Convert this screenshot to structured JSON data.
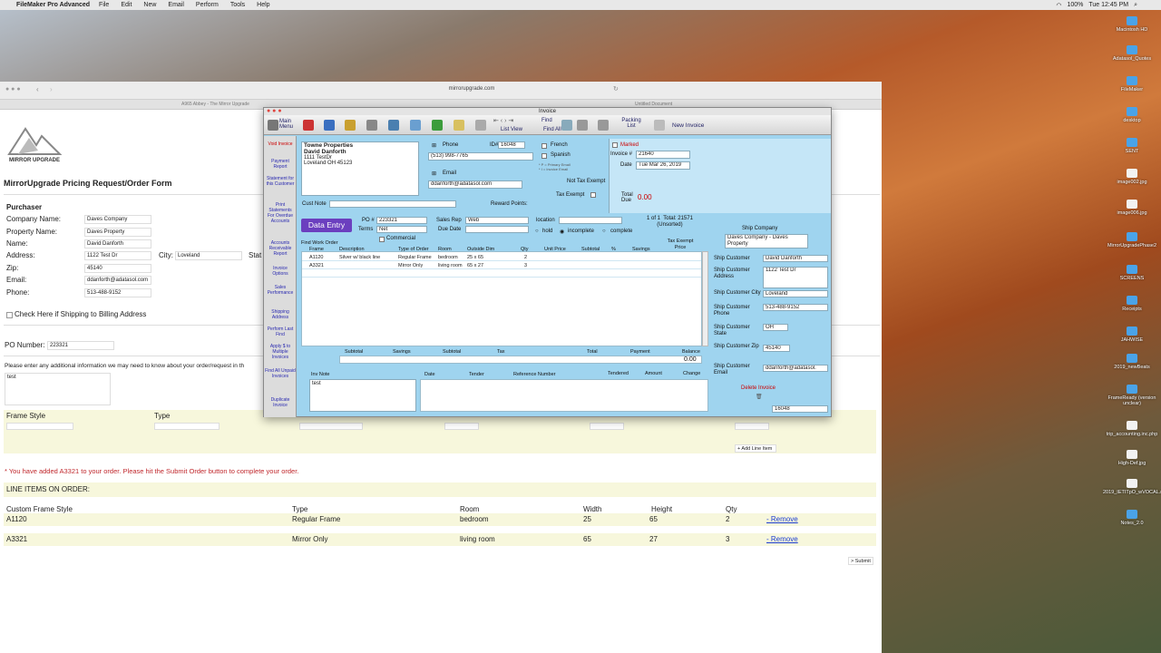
{
  "menubar": {
    "apple": "",
    "app": "FileMaker Pro Advanced",
    "items": [
      "File",
      "Edit",
      "New",
      "Email",
      "Perform",
      "Tools",
      "Help"
    ],
    "battery": "100%",
    "clock": "Tue 12:45 PM"
  },
  "desktop": [
    "Macintosh HD",
    "Adatasol_Quotes",
    "FileMaker",
    "desktop",
    "SENT",
    "image002.jpg",
    "image006.jpg",
    "MirrorUpgradePhase2",
    "SCREENS",
    "Receipts",
    "JAHWISE",
    "2019_newBeats",
    "FrameReady (version unclear)",
    "trip_accounting.inc.php",
    "High-Def.jpg",
    "2019_IETITpO_wVOCAL.mp3",
    "Notes_2.0"
  ],
  "safari": {
    "url": "mirrorupgrade.com",
    "tab1": "A965 Abbey - The Mirror Upgrade",
    "tab2": "Untitled Document"
  },
  "web": {
    "logo": "MIRROR UPGRADE",
    "heading": "MirrorUpgrade Pricing Request/Order Form",
    "purchaser": "Purchaser",
    "company_label": "Company Name:",
    "company": "Daves Company",
    "property_label": "Property Name:",
    "property": "Daves Property",
    "name_label": "Name:",
    "name": "David Danforth",
    "address_label": "Address:",
    "address": "1122 Test Dr",
    "city_label": "City:",
    "city": "Loveland",
    "state_label": "Stat",
    "zip_label": "Zip:",
    "zip": "45140",
    "email_label": "Email:",
    "email": "ddanforth@adatasol.com",
    "phone_label": "Phone:",
    "phone": "513-488-9152",
    "shipping_check": "Check Here if Shipping to Billing Address",
    "po_label": "PO Number:",
    "po": "223321",
    "info_text": "Please enter any additional information we may need to know about your order/request in th",
    "notes": "test",
    "frame_style_label": "Frame Style",
    "type_label": "Type",
    "add_line_item": "+ Add Line Item",
    "added_msg": "* You have added A3321 to your order. Please hit the Submit Order button to complete your order.",
    "line_items_title": "LINE ITEMS ON ORDER:",
    "cols": [
      "Custom Frame Style",
      "Type",
      "Room",
      "Width",
      "Height",
      "Qty"
    ],
    "rows": [
      {
        "style": "A1120",
        "type": "Regular Frame",
        "room": "bedroom",
        "width": "25",
        "height": "65",
        "qty": "2",
        "action": "- Remove"
      },
      {
        "style": "A3321",
        "type": "Mirror Only",
        "room": "living room",
        "width": "65",
        "height": "27",
        "qty": "3",
        "action": "- Remove"
      }
    ],
    "submit": "> Submit"
  },
  "fm": {
    "title": "Invoice",
    "toolbar": {
      "main_menu": "Main Menu",
      "list_view": "List View",
      "find": "Find",
      "find_all": "Find All",
      "packing": "Packing List",
      "new_invoice": "New Invoice"
    },
    "side": [
      "Void Invoice",
      "Payment Report",
      "Statement for this Customer",
      "Print Statements For Overdue Accounts",
      "Accounts Receivable Report",
      "Invoice Options",
      "Sales Performance",
      "Shipping Address",
      "Perform Last Find",
      "Apply $ to Multiple Invoices",
      "Find All Unpaid Invoices",
      "Duplicate Invoice"
    ],
    "bill_to": [
      "Towne Properties",
      "David Danforth",
      "1111 TestDr",
      "Loveland OH 45123"
    ],
    "phone_label": "Phone",
    "id_label": "ID#",
    "id": "16048",
    "phone": "(513) 998-7765",
    "french": "French",
    "spanish": "Spanish",
    "primary_note": "* P = Primary Email\n* I = Invoice Email",
    "email_label": "Email",
    "email": "ddanforth@adatasol.com",
    "not_tax_exempt": "Not Tax Exempt",
    "tax_exempt": "Tax Exempt",
    "marked": "Marked",
    "invoice_label": "Invoice #",
    "invoice": "21640",
    "date_label": "Date",
    "date": "Tue Mar 26, 2019",
    "total_due_label": "Total Due",
    "total_due": "0.00",
    "cust_note": "Cust Note",
    "reward_points": "Reward Points:",
    "data_entry": "Data Entry",
    "po_label": "PO #",
    "po": "223321",
    "terms_label": "Terms",
    "terms": "Net",
    "commercial": "Commercial",
    "sales_rep_label": "Sales Rep",
    "sales_rep": "Web",
    "due_date_label": "Due Date",
    "location_label": "location",
    "record_count": "1 of 1  Total: 21571\n(Unsorted)",
    "hold": "hold",
    "incomplete": "incomplete",
    "complete": "complete",
    "find_work_order": "Find Work Order",
    "cols": [
      "Frame",
      "Description",
      "Type of Order",
      "Room",
      "Outside Dim",
      "Qty",
      "Unit Price",
      "Subtotal",
      "%",
      "Savings",
      "Tax Exempt Price"
    ],
    "lines": [
      {
        "frame": "A1120",
        "desc": "Silver w/ black line",
        "type": "Regular Frame",
        "room": "bedroom",
        "dim": "25 x 65",
        "qty": "2"
      },
      {
        "frame": "A3321",
        "desc": "",
        "type": "Mirror Only",
        "room": "living room",
        "dim": "65 x 27",
        "qty": "3"
      }
    ],
    "totals": [
      "Subtotal",
      "Savings",
      "Subtotal",
      "Tax",
      "Total",
      "Payment",
      "Balance"
    ],
    "balance": "0.00",
    "inv_note": "Inv Note",
    "inv_note_val": "test",
    "pay_cols": [
      "Date",
      "Tender",
      "Reference Number",
      "Tendered",
      "Amount",
      "Change"
    ],
    "ship_company_label": "Ship Company",
    "ship_company": "Daves Company - Daves Property",
    "ship_customer_label": "Ship Customer",
    "ship_customer": "David Danforth",
    "ship_address_label": "Ship Customer Address",
    "ship_address": "1122 Test Dr",
    "ship_city_label": "Ship Customer City",
    "ship_city": "Loveland",
    "ship_phone_label": "Ship Customer Phone",
    "ship_phone": "513-488-9152",
    "ship_state_label": "Ship Customer State",
    "ship_state": "OH",
    "ship_zip_label": "Ship Customer Zip",
    "ship_zip": "45140",
    "ship_email_label": "Ship Customer Email",
    "ship_email": "ddanforth@adatasol.",
    "delete_invoice": "Delete Invoice",
    "id_bottom": "16048"
  }
}
